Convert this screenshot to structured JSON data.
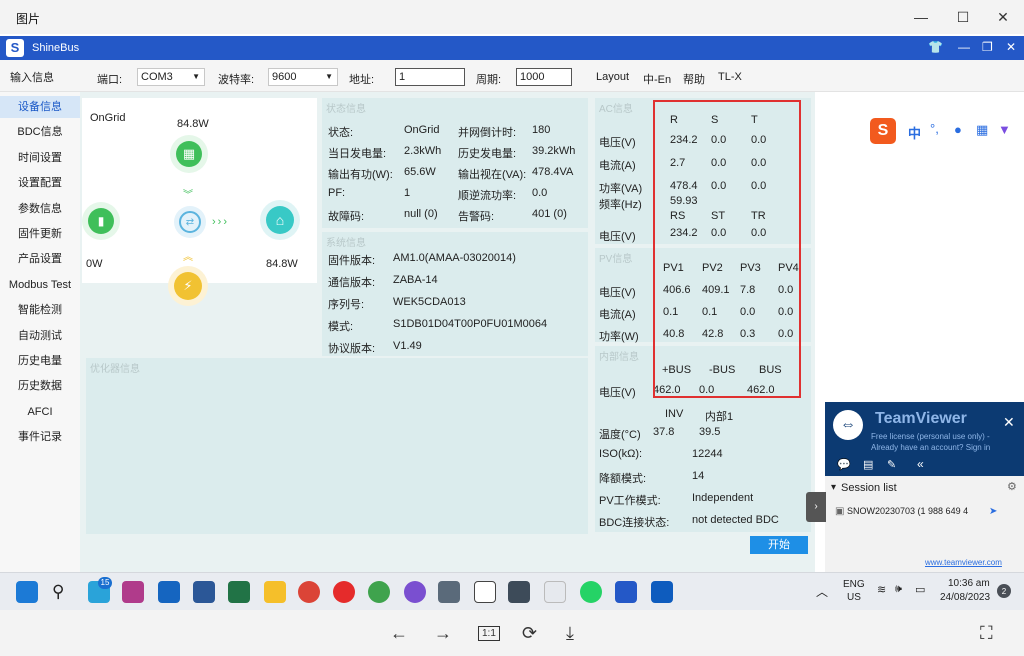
{
  "viewer": {
    "title": "图片",
    "bottom_actions": [
      "←",
      "→",
      "1:1",
      "⟳",
      "⤓",
      "⛶"
    ]
  },
  "app": {
    "title": "ShineBus",
    "logo": "S"
  },
  "toolbar": {
    "input_info": "输入信息",
    "port_label": "端口:",
    "port_value": "COM3",
    "baud_label": "波特率:",
    "baud_value": "9600",
    "addr_label": "地址:",
    "addr_value": "1",
    "period_label": "周期:",
    "period_value": "1000",
    "layout": "Layout",
    "lang": "中-En",
    "help": "帮助",
    "model": "TL-X"
  },
  "sidebar": {
    "items": [
      {
        "label": "设备信息",
        "active": true
      },
      {
        "label": "BDC信息"
      },
      {
        "label": "时间设置"
      },
      {
        "label": "设置配置"
      },
      {
        "label": "参数信息"
      },
      {
        "label": "固件更新"
      },
      {
        "label": "产品设置"
      },
      {
        "label": "Modbus Test"
      },
      {
        "label": "智能检测"
      },
      {
        "label": "自动测试"
      },
      {
        "label": "历史电量"
      },
      {
        "label": "历史数据"
      },
      {
        "label": "AFCI"
      },
      {
        "label": "事件记录"
      }
    ]
  },
  "overview": {
    "mode": "OnGrid",
    "pv_power": "84.8W",
    "battery_power": "0W",
    "home_power": "84.8W"
  },
  "status": {
    "title": "状态信息",
    "rows": [
      {
        "l1": "状态:",
        "v1": "OnGrid",
        "l2": "并网倒计时:",
        "v2": "180"
      },
      {
        "l1": "当日发电量:",
        "v1": "2.3kWh",
        "l2": "历史发电量:",
        "v2": "39.2kWh"
      },
      {
        "l1": "输出有功(W):",
        "v1": "65.6W",
        "l2": "输出视在(VA):",
        "v2": "478.4VA"
      },
      {
        "l1": "PF:",
        "v1": "1",
        "l2": "顺逆流功率:",
        "v2": "0.0"
      },
      {
        "l1": "故障码:",
        "v1": "null (0)",
        "l2": "告警码:",
        "v2": "401 (0)"
      }
    ]
  },
  "system": {
    "title": "系统信息",
    "rows": [
      {
        "label": "固件版本:",
        "value": "AM1.0(AMAA-03020014)"
      },
      {
        "label": "通信版本:",
        "value": "ZABA-14"
      },
      {
        "label": "序列号:",
        "value": "WEK5CDA013"
      },
      {
        "label": "模式:",
        "value": "S1DB01D04T00P0FU01M0064"
      },
      {
        "label": "协议版本:",
        "value": "V1.49"
      }
    ]
  },
  "optimizer": {
    "title": "优化器信息"
  },
  "ac": {
    "title": "AC信息",
    "headers": [
      "R",
      "S",
      "T"
    ],
    "rows": [
      {
        "label": "电压(V)",
        "values": [
          "234.2",
          "0.0",
          "0.0"
        ]
      },
      {
        "label": "电流(A)",
        "values": [
          "2.7",
          "0.0",
          "0.0"
        ]
      },
      {
        "label": "功率(VA)",
        "values": [
          "478.4",
          "0.0",
          "0.0"
        ]
      }
    ],
    "freq_label": "频率(Hz)",
    "freq_value": "59.93",
    "headers2": [
      "RS",
      "ST",
      "TR"
    ],
    "row2": {
      "label": "电压(V)",
      "values": [
        "234.2",
        "0.0",
        "0.0"
      ]
    }
  },
  "pv": {
    "title": "PV信息",
    "headers": [
      "PV1",
      "PV2",
      "PV3",
      "PV4"
    ],
    "rows": [
      {
        "label": "电压(V)",
        "values": [
          "406.6",
          "409.1",
          "7.8",
          "0.0"
        ]
      },
      {
        "label": "电流(A)",
        "values": [
          "0.1",
          "0.1",
          "0.0",
          "0.0"
        ]
      },
      {
        "label": "功率(W)",
        "values": [
          "40.8",
          "42.8",
          "0.3",
          "0.0"
        ]
      }
    ]
  },
  "internal": {
    "title": "内部信息",
    "headers": [
      "+BUS",
      "-BUS",
      "BUS"
    ],
    "voltage_label": "电压(V)",
    "voltage_values": [
      "462.0",
      "0.0",
      "462.0"
    ],
    "temp_headers": [
      "INV",
      "内部1"
    ],
    "temp_label": "温度(°C)",
    "temp_values": [
      "37.8",
      "39.5"
    ],
    "iso_label": "ISO(kΩ):",
    "iso_value": "12244",
    "derate_label": "降额模式:",
    "derate_value": "14",
    "pv_mode_label": "PV工作模式:",
    "pv_mode_value": "Independent",
    "bdc_label": "BDC连接状态:",
    "bdc_value": "not detected BDC"
  },
  "start_button": "开始",
  "teamviewer": {
    "title": "TeamViewer",
    "line1": "Free license (personal use only) -",
    "line2": "Already have an account? Sign in",
    "session_list": "Session list",
    "session": "SNOW20230703 (1 988 649 4",
    "url": "www.teamviewer.com"
  },
  "taskbar": {
    "badge": "15",
    "lang": "ENG",
    "region": "US",
    "time": "10:36 am",
    "date": "24/08/2023",
    "notif": "2"
  },
  "colors": {
    "accent": "#2458c7",
    "panel": "#dbeced",
    "highlight": "#e03030",
    "teamviewer": "#0c3a72"
  }
}
